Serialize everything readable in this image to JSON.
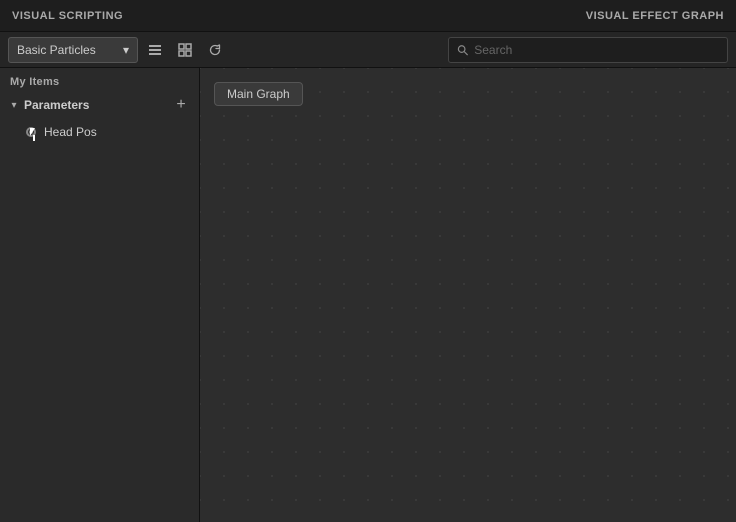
{
  "header": {
    "left_title": "VISUAL SCRIPTING",
    "right_title": "VISUAL EFFECT GRAPH"
  },
  "toolbar": {
    "dropdown_value": "Basic Particles",
    "dropdown_options": [
      "Basic Particles"
    ],
    "icon_list": "≡",
    "icon_layout": "⊡",
    "icon_refresh": "↺",
    "search_placeholder": "Search"
  },
  "sidebar": {
    "section_label": "My Items",
    "groups": [
      {
        "id": "parameters",
        "label": "Parameters",
        "expanded": true,
        "items": [
          {
            "id": "head-pos",
            "label": "Head Pos",
            "icon": "circle-dot"
          }
        ]
      }
    ]
  },
  "graph": {
    "tab_label": "Main Graph"
  }
}
